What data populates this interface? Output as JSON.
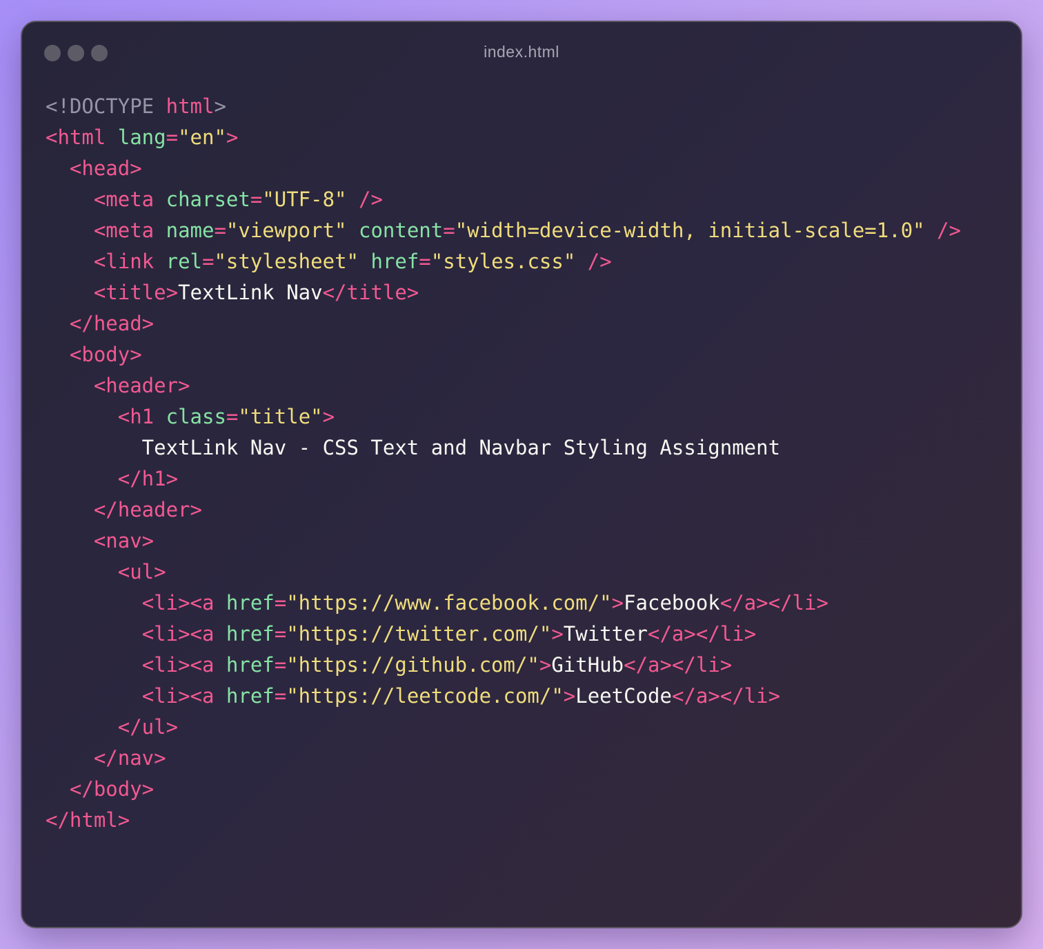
{
  "window": {
    "title": "index.html",
    "controls": [
      "window-dot",
      "window-dot",
      "window-dot"
    ]
  },
  "code": [
    [
      [
        "doctype",
        "<!DOCTYPE "
      ],
      [
        "tag",
        "html"
      ],
      [
        "doctype",
        ">"
      ]
    ],
    [
      [
        "tag",
        "<html "
      ],
      [
        "attr",
        "lang"
      ],
      [
        "punct",
        "="
      ],
      [
        "str",
        "\"en\""
      ],
      [
        "tag",
        ">"
      ]
    ],
    [
      [
        "text",
        "  "
      ],
      [
        "tag",
        "<head>"
      ]
    ],
    [
      [
        "text",
        "    "
      ],
      [
        "tag",
        "<meta "
      ],
      [
        "attr",
        "charset"
      ],
      [
        "punct",
        "="
      ],
      [
        "str",
        "\"UTF-8\""
      ],
      [
        "text",
        " "
      ],
      [
        "tag",
        "/>"
      ]
    ],
    [
      [
        "text",
        "    "
      ],
      [
        "tag",
        "<meta "
      ],
      [
        "attr",
        "name"
      ],
      [
        "punct",
        "="
      ],
      [
        "str",
        "\"viewport\""
      ],
      [
        "text",
        " "
      ],
      [
        "attr",
        "content"
      ],
      [
        "punct",
        "="
      ],
      [
        "str",
        "\"width=device-width, initial-scale=1.0\""
      ],
      [
        "text",
        " "
      ],
      [
        "tag",
        "/>"
      ]
    ],
    [
      [
        "text",
        "    "
      ],
      [
        "tag",
        "<link "
      ],
      [
        "attr",
        "rel"
      ],
      [
        "punct",
        "="
      ],
      [
        "str",
        "\"stylesheet\""
      ],
      [
        "text",
        " "
      ],
      [
        "attr",
        "href"
      ],
      [
        "punct",
        "="
      ],
      [
        "str",
        "\"styles.css\""
      ],
      [
        "text",
        " "
      ],
      [
        "tag",
        "/>"
      ]
    ],
    [
      [
        "text",
        "    "
      ],
      [
        "tag",
        "<title>"
      ],
      [
        "text",
        "TextLink Nav"
      ],
      [
        "tag",
        "</title>"
      ]
    ],
    [
      [
        "text",
        "  "
      ],
      [
        "tag",
        "</head>"
      ]
    ],
    [
      [
        "text",
        "  "
      ],
      [
        "tag",
        "<body>"
      ]
    ],
    [
      [
        "text",
        "    "
      ],
      [
        "tag",
        "<header>"
      ]
    ],
    [
      [
        "text",
        "      "
      ],
      [
        "tag",
        "<h1 "
      ],
      [
        "attr",
        "class"
      ],
      [
        "punct",
        "="
      ],
      [
        "str",
        "\"title\""
      ],
      [
        "tag",
        ">"
      ]
    ],
    [
      [
        "text",
        "        TextLink Nav - CSS Text and Navbar Styling Assignment"
      ]
    ],
    [
      [
        "text",
        "      "
      ],
      [
        "tag",
        "</h1>"
      ]
    ],
    [
      [
        "text",
        "    "
      ],
      [
        "tag",
        "</header>"
      ]
    ],
    [
      [
        "text",
        "    "
      ],
      [
        "tag",
        "<nav>"
      ]
    ],
    [
      [
        "text",
        "      "
      ],
      [
        "tag",
        "<ul>"
      ]
    ],
    [
      [
        "text",
        "        "
      ],
      [
        "tag",
        "<li><a "
      ],
      [
        "attr",
        "href"
      ],
      [
        "punct",
        "="
      ],
      [
        "str",
        "\"https://www.facebook.com/\""
      ],
      [
        "tag",
        ">"
      ],
      [
        "text",
        "Facebook"
      ],
      [
        "tag",
        "</a></li>"
      ]
    ],
    [
      [
        "text",
        "        "
      ],
      [
        "tag",
        "<li><a "
      ],
      [
        "attr",
        "href"
      ],
      [
        "punct",
        "="
      ],
      [
        "str",
        "\"https://twitter.com/\""
      ],
      [
        "tag",
        ">"
      ],
      [
        "text",
        "Twitter"
      ],
      [
        "tag",
        "</a></li>"
      ]
    ],
    [
      [
        "text",
        "        "
      ],
      [
        "tag",
        "<li><a "
      ],
      [
        "attr",
        "href"
      ],
      [
        "punct",
        "="
      ],
      [
        "str",
        "\"https://github.com/\""
      ],
      [
        "tag",
        ">"
      ],
      [
        "text",
        "GitHub"
      ],
      [
        "tag",
        "</a></li>"
      ]
    ],
    [
      [
        "text",
        "        "
      ],
      [
        "tag",
        "<li><a "
      ],
      [
        "attr",
        "href"
      ],
      [
        "punct",
        "="
      ],
      [
        "str",
        "\"https://leetcode.com/\""
      ],
      [
        "tag",
        ">"
      ],
      [
        "text",
        "LeetCode"
      ],
      [
        "tag",
        "</a></li>"
      ]
    ],
    [
      [
        "text",
        "      "
      ],
      [
        "tag",
        "</ul>"
      ]
    ],
    [
      [
        "text",
        "    "
      ],
      [
        "tag",
        "</nav>"
      ]
    ],
    [
      [
        "text",
        "  "
      ],
      [
        "tag",
        "</body>"
      ]
    ],
    [
      [
        "tag",
        "</html>"
      ]
    ]
  ],
  "colors": {
    "tag": "#f25991",
    "attribute": "#86e3a4",
    "string": "#f0dd7c",
    "text": "#f8f8f2",
    "doctype": "#9894a8"
  }
}
